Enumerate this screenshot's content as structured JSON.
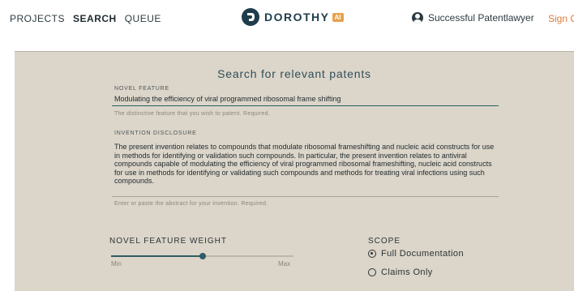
{
  "nav": {
    "projects": "PROJECTS",
    "search": "SEARCH",
    "queue": "QUEUE"
  },
  "brand": {
    "name": "DOROTHY",
    "badge": "AI"
  },
  "user": {
    "name": "Successful Patentlawyer",
    "signout": "Sign O"
  },
  "form": {
    "title": "Search for relevant patents",
    "novel_feature": {
      "label": "NOVEL FEATURE",
      "value": "Modulating the efficiency of viral programmed ribosomal frame shifting",
      "helper": "The distinctive feature that you wish to patent. Required."
    },
    "disclosure": {
      "label": "INVENTION DISCLOSURE",
      "value": "The present invention relates to compounds that modulate ribosomal frameshifting and nucleic acid constructs for use in methods for identifying or validation such compounds. In particular, the present invention relates to antiviral compounds capable of modulating the efficiency of viral programmed ribosomal frameshifting, nucleic acid constructs for use in methods for identifying or validating such compounds and methods for treating viral infections using such compounds.",
      "helper": "Enter or paste the abstract for your invention. Required."
    },
    "weight": {
      "label": "NOVEL FEATURE WEIGHT",
      "min": "Min",
      "max": "Max",
      "value_fraction": 0.5
    },
    "scope": {
      "label": "SCOPE",
      "options": [
        {
          "label": "Full Documentation",
          "selected": true
        },
        {
          "label": "Claims Only",
          "selected": false
        }
      ]
    }
  },
  "colors": {
    "panel": "#dcd5c9",
    "accent": "#2f5b66",
    "brand": "#1f3d4a",
    "signout": "#e07a3c",
    "badge": "#e7a24c"
  }
}
